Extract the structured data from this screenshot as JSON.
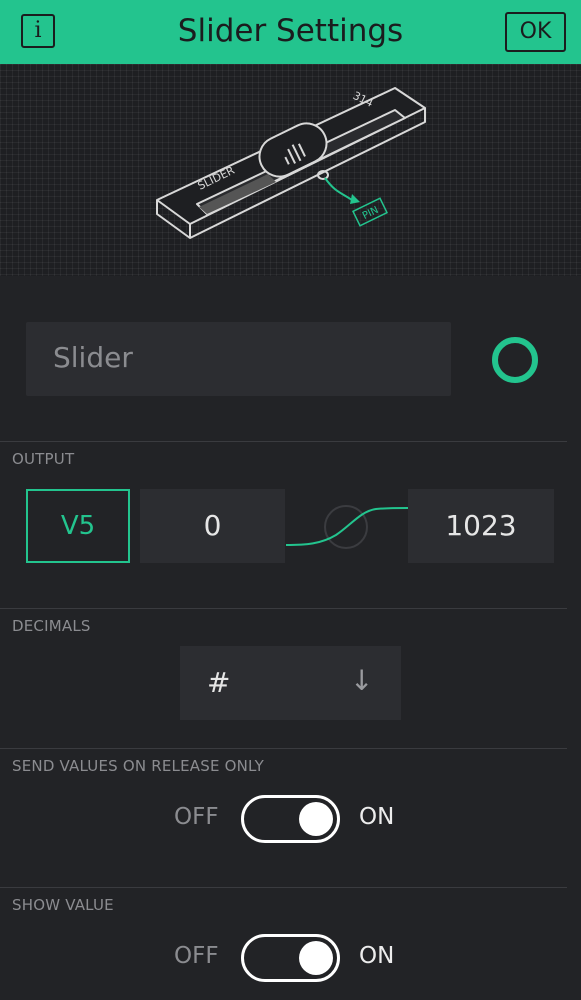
{
  "header": {
    "title": "Slider Settings",
    "info_label": "i",
    "ok_label": "OK",
    "accent_color": "#23c48e"
  },
  "illustration": {
    "widget_label": "SLIDER",
    "value_label": "314",
    "pin_label": "PIN"
  },
  "name_field": {
    "value": "Slider",
    "color": "#23c48e"
  },
  "output": {
    "label": "OUTPUT",
    "pin": "V5",
    "min": "0",
    "max": "1023"
  },
  "decimals": {
    "label": "DECIMALS",
    "value": "#",
    "arrow_icon": "arrow-down-icon"
  },
  "send_on_release": {
    "label": "SEND VALUES ON RELEASE ONLY",
    "off_label": "OFF",
    "on_label": "ON",
    "state": "on"
  },
  "show_value": {
    "label": "SHOW VALUE",
    "off_label": "OFF",
    "on_label": "ON",
    "state": "on"
  }
}
